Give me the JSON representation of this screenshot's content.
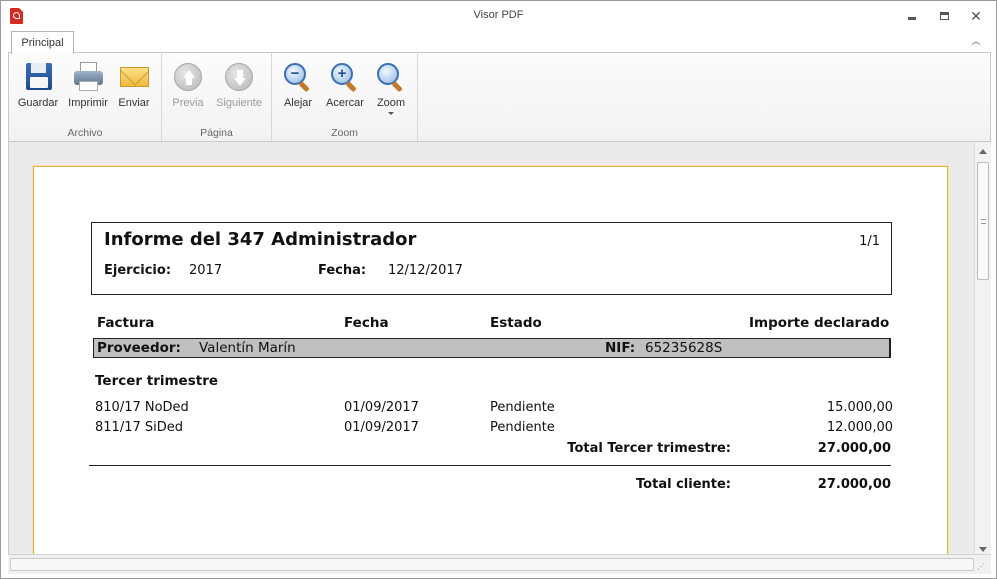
{
  "window": {
    "title": "Visor PDF"
  },
  "ribbon": {
    "tab": "Principal",
    "groups": [
      {
        "label": "Archivo",
        "buttons": [
          "Guardar",
          "Imprimir",
          "Enviar"
        ]
      },
      {
        "label": "Página",
        "buttons": [
          "Previa",
          "Siguiente"
        ]
      },
      {
        "label": "Zoom",
        "buttons": [
          "Alejar",
          "Acercar",
          "Zoom"
        ]
      }
    ]
  },
  "report": {
    "title": "Informe del 347 Administrador",
    "page": "1/1",
    "ejercicio_label": "Ejercicio:",
    "ejercicio": "2017",
    "fecha_label": "Fecha:",
    "fecha": "12/12/2017",
    "columns": [
      "Factura",
      "Fecha",
      "Estado",
      "Importe declarado"
    ],
    "proveedor_label": "Proveedor:",
    "proveedor": "Valentín Marín",
    "nif_label": "NIF:",
    "nif": "65235628S",
    "section": "Tercer trimestre",
    "rows": [
      {
        "factura": "810/17 NoDed",
        "fecha": "01/09/2017",
        "estado": "Pendiente",
        "importe": "15.000,00"
      },
      {
        "factura": "811/17 SiDed",
        "fecha": "01/09/2017",
        "estado": "Pendiente",
        "importe": "12.000,00"
      }
    ],
    "section_total_label": "Total Tercer trimestre:",
    "section_total": "27.000,00",
    "client_total_label": "Total cliente:",
    "client_total": "27.000,00"
  }
}
